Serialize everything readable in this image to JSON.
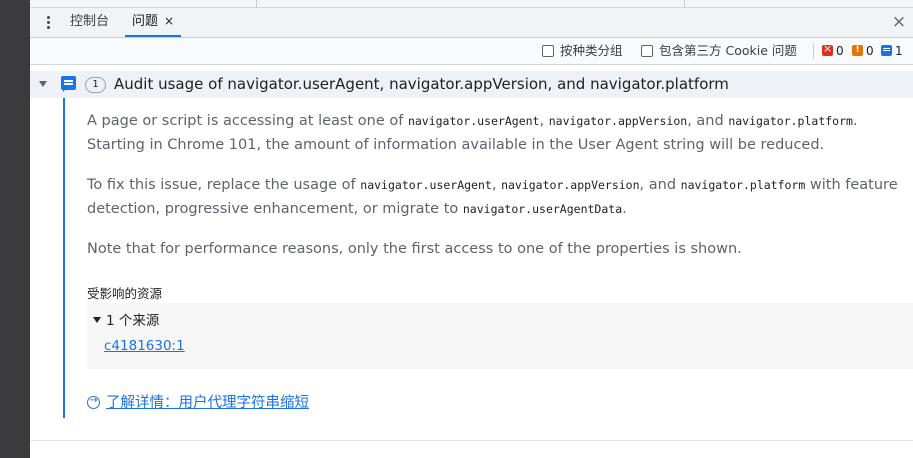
{
  "tabs": [
    {
      "label": "控制台"
    },
    {
      "label": "问题",
      "close": "×"
    }
  ],
  "close_panel": "×",
  "toolbar": {
    "group_by_kind": "按种类分组",
    "include_third_party": "包含第三方 Cookie 问题",
    "counts": {
      "errors": "0",
      "warnings": "0",
      "info": "1"
    }
  },
  "issue": {
    "count": "1",
    "title": "Audit usage of navigator.userAgent, navigator.appVersion, and navigator.platform",
    "p1": {
      "t1": "A page or script is accessing at least one of ",
      "c1": "navigator.userAgent",
      "t2": ", ",
      "c2": "navigator.appVersion",
      "t3": ", and ",
      "c3": "navigator.platform",
      "t4": ". Starting in Chrome 101, the amount of information available in the User Agent string will be reduced."
    },
    "p2": {
      "t1": "To fix this issue, replace the usage of ",
      "c1": "navigator.userAgent",
      "t2": ", ",
      "c2": "navigator.appVersion",
      "t3": ", and ",
      "c3": "navigator.platform",
      "t4": " with feature detection, progressive enhancement, or migrate to ",
      "c4": "navigator.userAgentData",
      "t5": "."
    },
    "p3": "Note that for performance reasons, only the first access to one of the properties is shown.",
    "affected_label": "受影响的资源",
    "sources_label": "1 个来源",
    "source_link": "c4181630:1",
    "learn_more": "了解详情：用户代理字符串缩短"
  },
  "icons": {
    "more": "kebab-menu-icon",
    "error": "error-icon",
    "warning": "warning-icon",
    "info": "info-icon",
    "issue": "issue-message-icon",
    "learn_more": "arrow-circle-icon"
  },
  "colors": {
    "accent": "#1a73e8",
    "error": "#d93025",
    "warning": "#e37400",
    "header_bg": "#eef1f6"
  }
}
